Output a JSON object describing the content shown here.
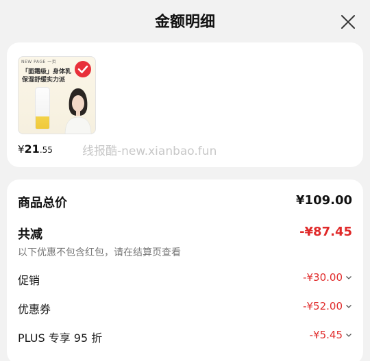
{
  "header": {
    "title": "金额明细",
    "close_icon": "close-icon"
  },
  "product": {
    "image": {
      "brand": "NEW PAGE 一页",
      "promo_line_1": "「面霜级」身体乳",
      "promo_line_2": "保湿舒缓实力派"
    },
    "price_currency": "¥",
    "price_integer": "21",
    "price_decimal": ".55",
    "watermark": "线报酷-new.xianbao.fun"
  },
  "summary": {
    "total_label": "商品总价",
    "total_value": "¥109.00",
    "reduce_label": "共减",
    "reduce_value": "-¥87.45",
    "note": "以下优惠不包含红包，请在结算页查看",
    "lines": [
      {
        "label": "促销",
        "value": "-¥30.00"
      },
      {
        "label": "优惠券",
        "value": "-¥52.00"
      },
      {
        "label": "PLUS 专享 95 折",
        "value": "-¥5.45"
      }
    ]
  },
  "colors": {
    "accent": "#e02a2a",
    "background": "#f2f2f2",
    "card": "#ffffff"
  }
}
